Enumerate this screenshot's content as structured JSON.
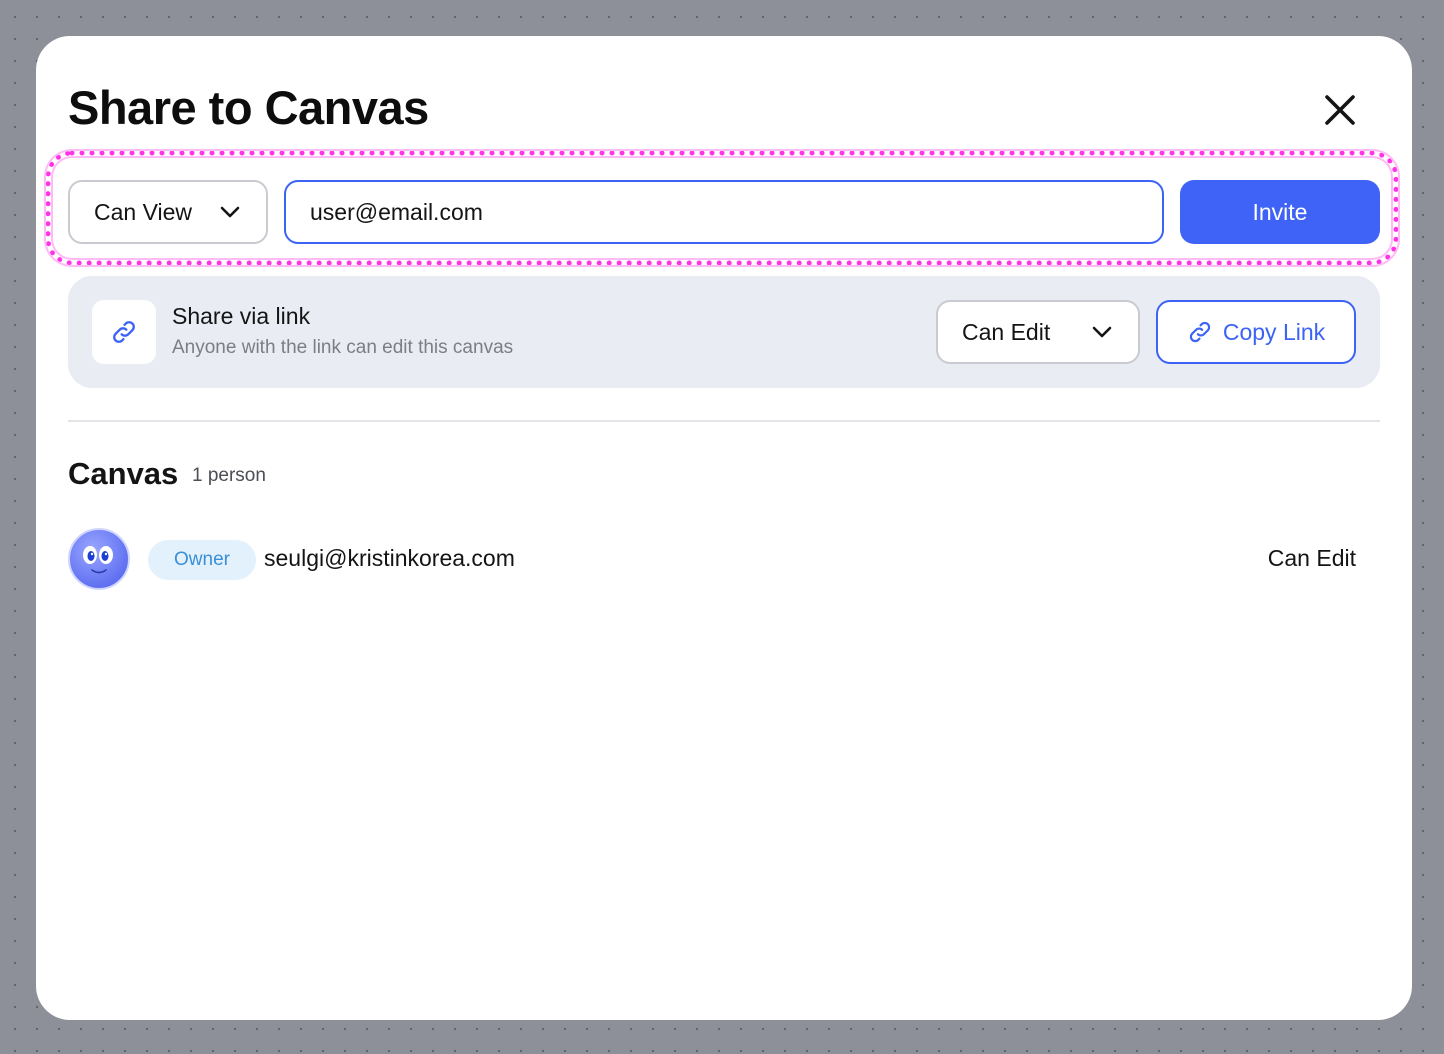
{
  "dialog": {
    "title": "Share to Canvas"
  },
  "invite": {
    "permission": "Can View",
    "email_value": "user@email.com",
    "button_label": "Invite"
  },
  "link_share": {
    "title": "Share via link",
    "subtitle": "Anyone with the link can edit this canvas",
    "permission": "Can Edit",
    "copy_label": "Copy Link"
  },
  "members": {
    "section_title": "Canvas",
    "count_label": "1 person",
    "items": [
      {
        "role": "Owner",
        "email": "seulgi@kristinkorea.com",
        "permission": "Can Edit"
      }
    ]
  },
  "colors": {
    "accent": "#3e63f6",
    "highlight": "#ff33e6",
    "badge_bg": "#e3f1fd",
    "badge_text": "#3a8fd6",
    "panel_bg": "#e9ecf3"
  },
  "icons": [
    "close-icon",
    "chevron-down-icon",
    "link-icon",
    "avatar"
  ]
}
